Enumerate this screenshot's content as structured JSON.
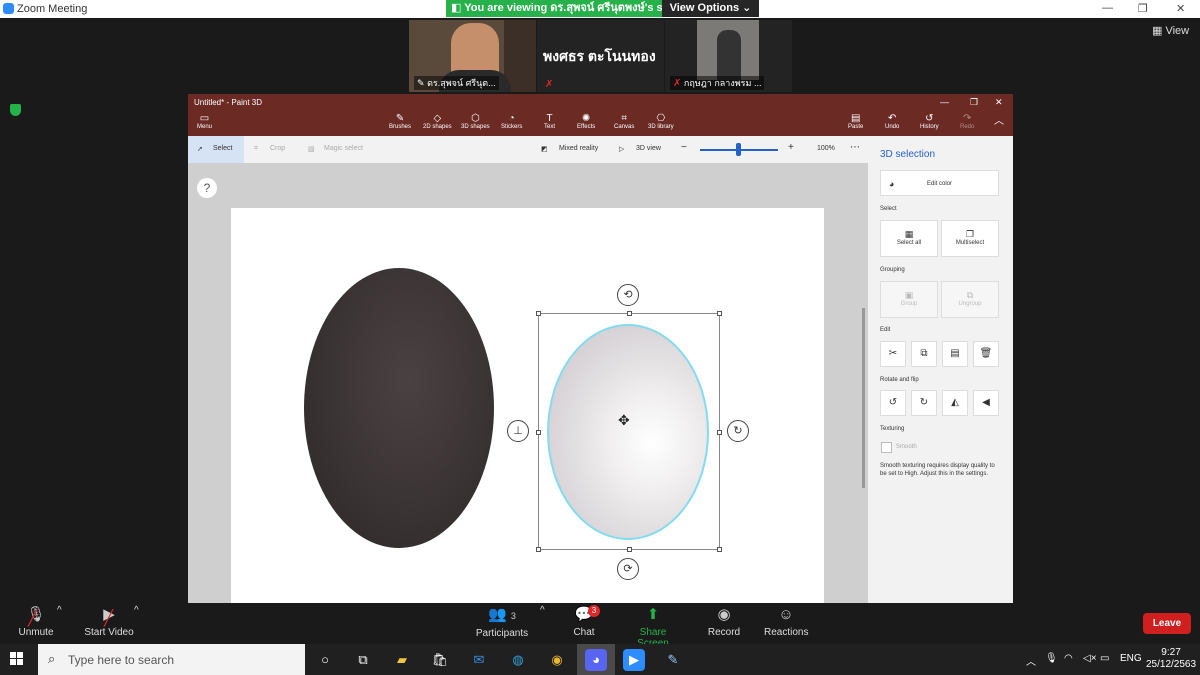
{
  "zoom": {
    "window_title": "Zoom Meeting",
    "banner_text": "You are viewing ดร.สุพจน์ ศรีนุตพงษ์'s screen",
    "view_options_label": "View Options",
    "view_label": "View",
    "participants": [
      {
        "name": "ดร.สุพจน์ ศรีนุต..."
      },
      {
        "name": "พงศธร ตะโนนทอง"
      },
      {
        "name": "กฤษฎา กลางพรม ..."
      }
    ],
    "controls": {
      "unmute": "Unmute",
      "start_video": "Start Video",
      "participants": "Participants",
      "participants_count": "3",
      "chat": "Chat",
      "chat_badge": "3",
      "share_screen": "Share Screen",
      "record": "Record",
      "reactions": "Reactions",
      "leave": "Leave"
    }
  },
  "paint3d": {
    "title": "Untitled* - Paint 3D",
    "ribbon": {
      "menu": "Menu",
      "brushes": "Brushes",
      "shapes2d": "2D shapes",
      "shapes3d": "3D shapes",
      "stickers": "Stickers",
      "text": "Text",
      "effects": "Effects",
      "canvas": "Canvas",
      "library3d": "3D library",
      "paste": "Paste",
      "undo": "Undo",
      "history": "History",
      "redo": "Redo"
    },
    "toolbar": {
      "select": "Select",
      "crop": "Crop",
      "magic_select": "Magic select",
      "mixed_reality": "Mixed reality",
      "view3d": "3D view",
      "zoom_value": "100%"
    },
    "panel": {
      "title": "3D selection",
      "edit_color": "Edit color",
      "select_section": "Select",
      "select_all": "Select all",
      "multiselect": "Multiselect",
      "grouping_section": "Grouping",
      "group": "Group",
      "ungroup": "Ungroup",
      "edit_section": "Edit",
      "rotate_section": "Rotate and flip",
      "texturing_section": "Texturing",
      "smooth": "Smooth",
      "smooth_note": "Smooth texturing requires display quality to be set to High. Adjust this in the settings."
    }
  },
  "taskbar": {
    "search_placeholder": "Type here to search",
    "language": "ENG",
    "time": "9:27",
    "date": "25/12/2563"
  }
}
